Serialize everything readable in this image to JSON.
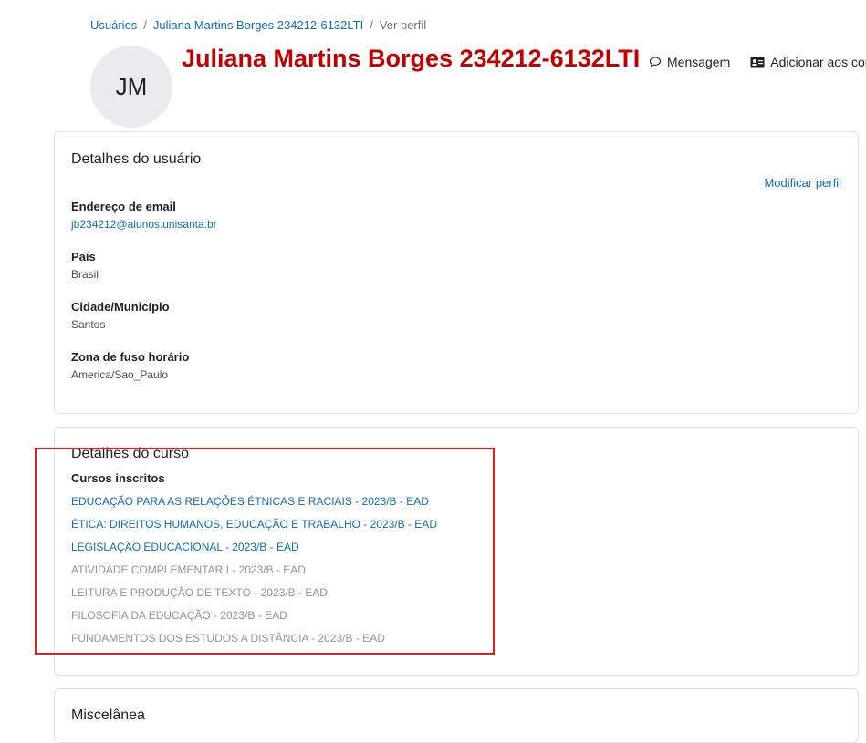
{
  "breadcrumb": {
    "items": [
      "Usuários",
      "Juliana Martins Borges 234212-6132LTI",
      "Ver perfil"
    ],
    "separator": "/"
  },
  "profile": {
    "avatar_initials": "JM",
    "name": "Juliana Martins Borges 234212-6132LTI",
    "name_color": "#c00000"
  },
  "header_actions": {
    "message_label": "Mensagem",
    "add_contacts_label": "Adicionar aos contatos"
  },
  "user_details": {
    "title": "Detalhes do usuário",
    "edit_link": "Modificar perfil",
    "fields": [
      {
        "label": "Endereço de email",
        "value": "jb234212@alunos.unisanta.br"
      },
      {
        "label": "País",
        "value": "Brasil"
      },
      {
        "label": "Cidade/Município",
        "value": "Santos"
      },
      {
        "label": "Zona de fuso horário",
        "value": "America/Sao_Paulo"
      }
    ]
  },
  "course_details": {
    "title": "Detalhes do curso",
    "subtitle": "Cursos inscritos",
    "courses": [
      "EDUCAÇÃO PARA AS RELAÇÕES ÉTNICAS E RACIAIS - 2023/B - EAD",
      "ÉTICA: DIREITOS HUMANOS, EDUCAÇÃO E TRABALHO - 2023/B - EAD",
      "LEGISLAÇÃO EDUCACIONAL - 2023/B - EAD",
      "ATIVIDADE COMPLEMENTAR I - 2023/B - EAD",
      "LEITURA E PRODUÇÃO DE TEXTO - 2023/B - EAD",
      "FILOSOFIA DA EDUCAÇÃO - 2023/B - EAD",
      "FUNDAMENTOS DOS ESTUDOS A DISTÂNCIA - 2023/B - EAD"
    ]
  },
  "misc": {
    "title": "Miscelânea"
  },
  "colors": {
    "link": "#0f6cbf",
    "highlight": "#e02020"
  }
}
